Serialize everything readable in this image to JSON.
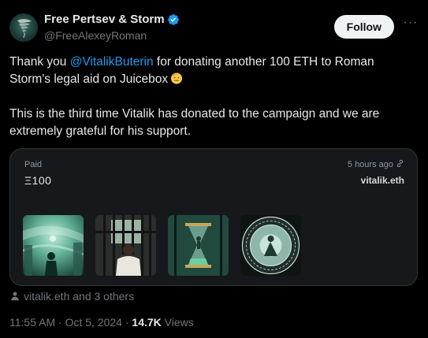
{
  "author": {
    "display_name": "Free Pertsev & Storm",
    "handle": "@FreeAlexeyRoman",
    "verified": true
  },
  "follow_label": "Follow",
  "more_label": "···",
  "tweet": {
    "part1_prefix": "Thank you ",
    "mention": "@VitalikButerin",
    "part1_suffix": " for donating another 100 ETH to Roman Storm's legal aid on Juicebox",
    "emoji": "saluting-face",
    "paragraph2": "This is the third time Vitalik has donated to the campaign and we are extremely grateful for his support."
  },
  "card": {
    "paid_label": "Paid",
    "amount": "Ξ100",
    "time_ago": "5 hours ago",
    "payer": "vitalik.eth",
    "thumbnails": [
      "green-storm-figure",
      "prison-bars-man",
      "hourglass-prison",
      "circular-seal"
    ]
  },
  "likers": "vitalik.eth and 3 others",
  "meta": {
    "time": "11:55 AM",
    "separator": "·",
    "date": "Oct 5, 2024",
    "views_count": "14.7K",
    "views_label": "Views"
  },
  "colors": {
    "background": "#000000",
    "text": "#e7e9ea",
    "secondary": "#71767b",
    "mention": "#1d9bf0",
    "verified": "#1d9bf0",
    "card_bg": "#16181c",
    "card_border": "#2f3336"
  }
}
